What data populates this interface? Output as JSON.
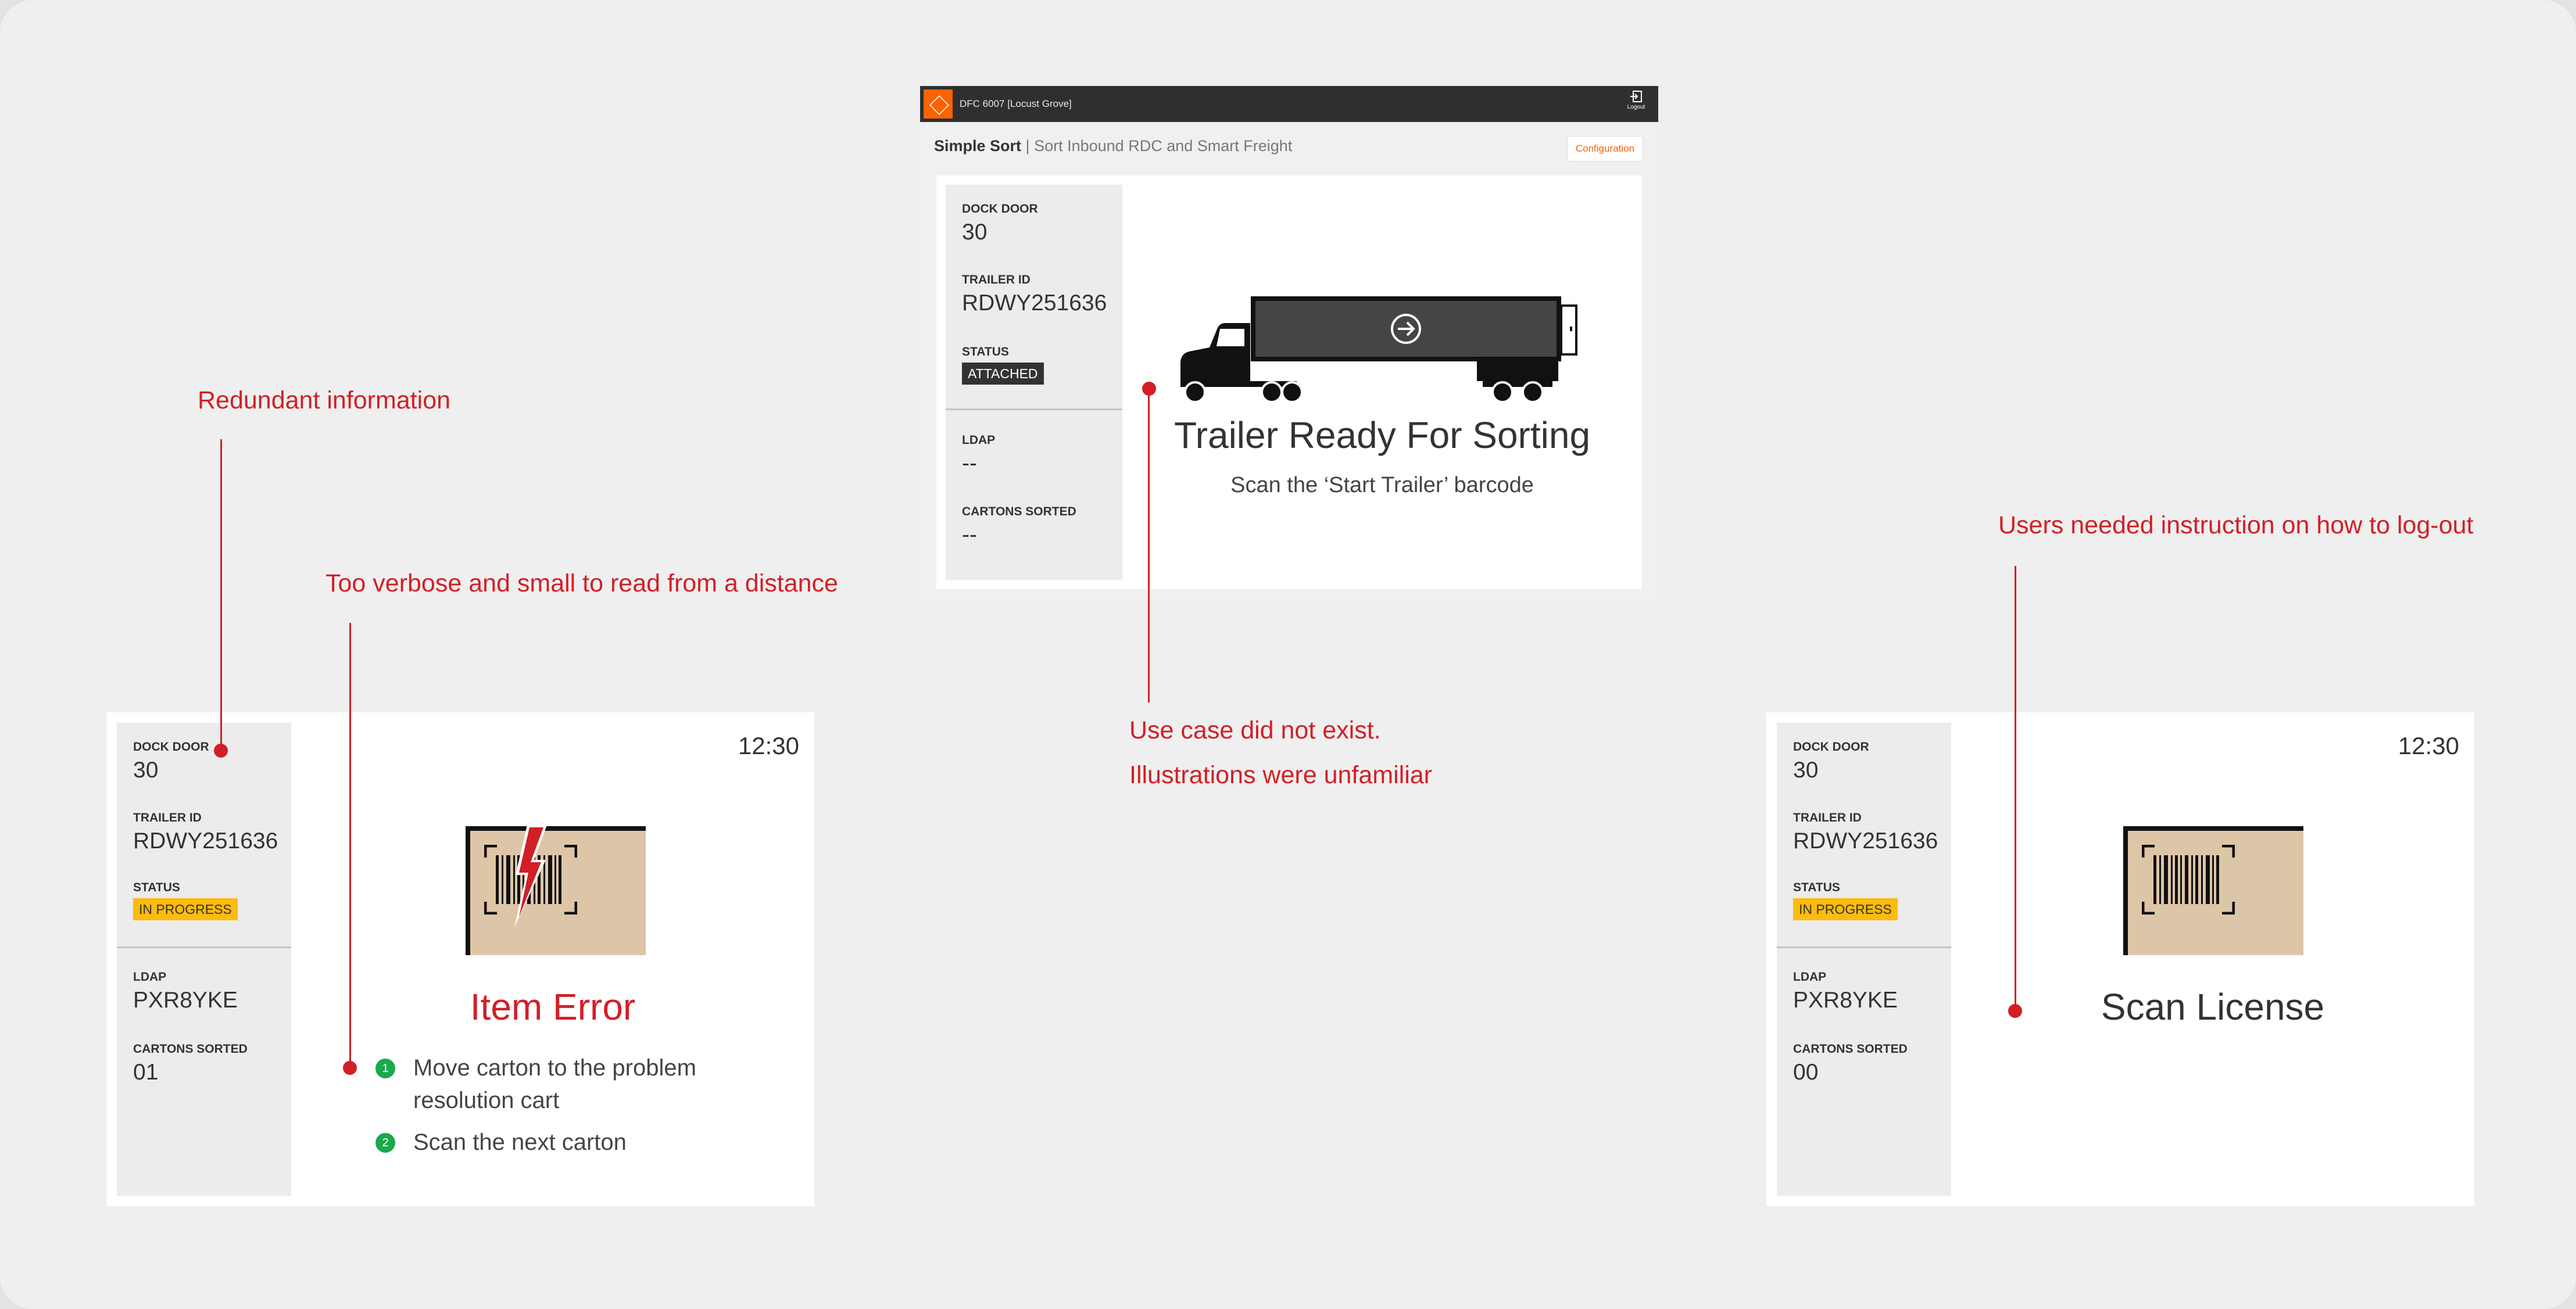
{
  "top_app": {
    "store": "DFC 6007 [Locust Grove]",
    "logout_label": "Logout",
    "app_name": "Simple Sort",
    "separator": "|",
    "subtitle": "Sort Inbound RDC and Smart Freight",
    "config_button": "Configuration",
    "sidebar": {
      "dock_door_label": "DOCK DOOR",
      "dock_door_value": "30",
      "trailer_id_label": "TRAILER ID",
      "trailer_id_value": "RDWY251636",
      "status_label": "STATUS",
      "status_value": "ATTACHED",
      "ldap_label": "LDAP",
      "ldap_value": "--",
      "cartons_label": "CARTONS SORTED",
      "cartons_value": "--"
    },
    "headline": "Trailer Ready For Sorting",
    "instruction": "Scan the ‘Start Trailer’ barcode"
  },
  "error_card": {
    "time": "12:30",
    "sidebar": {
      "dock_door_label": "DOCK DOOR",
      "dock_door_value": "30",
      "trailer_id_label": "TRAILER ID",
      "trailer_id_value": "RDWY251636",
      "status_label": "STATUS",
      "status_value": "IN PROGRESS",
      "ldap_label": "LDAP",
      "ldap_value": "PXR8YKE",
      "cartons_label": "CARTONS SORTED",
      "cartons_value": "01"
    },
    "title": "Item Error",
    "steps": [
      {
        "num": "1",
        "line1": "Move carton to the problem",
        "line2": "resolution cart"
      },
      {
        "num": "2",
        "line1": "Scan the next carton"
      }
    ]
  },
  "license_card": {
    "time": "12:30",
    "sidebar": {
      "dock_door_label": "DOCK DOOR",
      "dock_door_value": "30",
      "trailer_id_label": "TRAILER ID",
      "trailer_id_value": "RDWY251636",
      "status_label": "STATUS",
      "status_value": "IN PROGRESS",
      "ldap_label": "LDAP",
      "ldap_value": "PXR8YKE",
      "cartons_label": "CARTONS SORTED",
      "cartons_value": "00"
    },
    "title": "Scan License"
  },
  "annotations": {
    "redundant": "Redundant information",
    "verbose": "Too verbose and small to read from a distance",
    "use_case_1": "Use case did not exist.",
    "use_case_2": "Illustrations were unfamiliar",
    "logout": "Users needed instruction on how to log-out"
  },
  "icons": {
    "logo": "home-depot-logo",
    "logout": "logout-icon",
    "truck": "truck-illustration",
    "arrow": "arrow-right-circle-icon",
    "barcode": "barcode-icon",
    "error": "lightning-bolt-icon",
    "step": "step-number-badge"
  },
  "colors": {
    "annotation": "#d21f26",
    "brand_orange": "#f96302",
    "in_progress": "#fcbb0d",
    "step_green": "#1ba94c",
    "appbar": "#2d2f31"
  }
}
